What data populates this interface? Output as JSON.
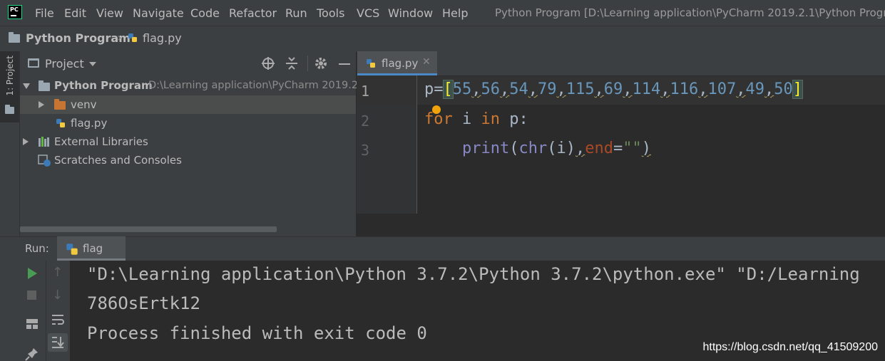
{
  "menu": {
    "items": [
      "File",
      "Edit",
      "View",
      "Navigate",
      "Code",
      "Refactor",
      "Run",
      "Tools",
      "VCS",
      "Window",
      "Help"
    ],
    "window_title": "Python Program [D:\\Learning application\\PyCharm 2019.2.1\\Python Program"
  },
  "breadcrumb": {
    "project": "Python Program",
    "file": "flag.py"
  },
  "left_strip": {
    "project_label": "1: Project"
  },
  "project_panel": {
    "title": "Project",
    "root": {
      "name": "Python Program",
      "path": "D:\\Learning application\\PyCharm 2019.2"
    },
    "venv": "venv",
    "file": "flag.py",
    "external_libraries": "External Libraries",
    "scratches": "Scratches and Consoles"
  },
  "editor": {
    "tab": "flag.py",
    "line_numbers": [
      "1",
      "2",
      "3"
    ],
    "line1": {
      "var": "p",
      "eq": "=",
      "open_bracket": "[",
      "numbers": [
        "55",
        "56",
        "54",
        "79",
        "115",
        "69",
        "114",
        "116",
        "107",
        "49",
        "50"
      ],
      "close_bracket": "]"
    },
    "line2": {
      "kw_for": "for",
      "var": " i ",
      "kw_in": "in",
      "rest": " p:"
    },
    "line3": {
      "indent": "    ",
      "print": "print",
      "open": "(",
      "chr": "chr",
      "args": "(i)",
      "comma": ",",
      "end_param": "end",
      "eq": "=",
      "str": "\"\"",
      "close": ")"
    }
  },
  "run": {
    "label": "Run:",
    "tab": "flag",
    "console_lines": [
      "\"D:\\Learning application\\Python 3.7.2\\Python 3.7.2\\python.exe\" \"D:/Learning",
      "786OsErtk12",
      "Process finished with exit code 0"
    ]
  },
  "watermark": "https://blog.csdn.net/qq_41509200",
  "colors": {
    "keyword": "#cc7832",
    "number": "#6897bb",
    "builtin": "#8888c6",
    "param": "#aa4926",
    "string": "#6a8759",
    "run_green": "#499c54"
  }
}
